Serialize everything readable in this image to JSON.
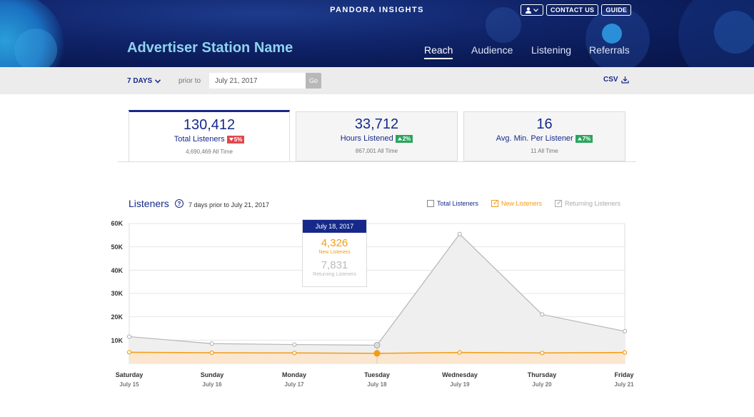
{
  "header": {
    "brand": "PANDORA INSIGHTS",
    "contact_label": "CONTACT US",
    "guide_label": "GUIDE",
    "station_name": "Advertiser Station Name",
    "nav": [
      "Reach",
      "Audience",
      "Listening",
      "Referrals"
    ],
    "active_nav": "Reach",
    "user_icon": "user-icon"
  },
  "filters": {
    "range_label": "7 DAYS",
    "prior_label": "prior to",
    "date_value": "July 21, 2017",
    "go_label": "Go",
    "csv_label": "CSV"
  },
  "stats": [
    {
      "value": "130,412",
      "label": "Total Listeners",
      "change": "5%",
      "direction": "down",
      "all_time": "4,690,469 All Time"
    },
    {
      "value": "33,712",
      "label": "Hours Listened",
      "change": "2%",
      "direction": "up",
      "all_time": "867,001 All Time"
    },
    {
      "value": "16",
      "label": "Avg. Min. Per Listener",
      "change": "7%",
      "direction": "up",
      "all_time": "11 All Time"
    }
  ],
  "chart": {
    "title": "Listeners",
    "subtitle": "7 days prior to July 21, 2017",
    "legend": [
      {
        "label": "Total Listeners",
        "checked": false,
        "color": "#16298a"
      },
      {
        "label": "New Listeners",
        "checked": true,
        "color": "#f39c12"
      },
      {
        "label": "Returning Listeners",
        "checked": true,
        "color": "#aaaaaa"
      }
    ],
    "tooltip": {
      "date": "July 18, 2017",
      "new_value": "4,326",
      "new_label": "New Listeners",
      "returning_value": "7,831",
      "returning_label": "Returning Listeners"
    },
    "days": [
      "Saturday",
      "Sunday",
      "Monday",
      "Tuesday",
      "Wednesday",
      "Thursday",
      "Friday"
    ],
    "dates": [
      "July 15",
      "July 16",
      "July 17",
      "July 18",
      "July 19",
      "July 20",
      "July 21"
    ],
    "y_ticks": [
      "60K",
      "50K",
      "40K",
      "30K",
      "20K",
      "10K"
    ]
  },
  "chart_data": {
    "type": "area",
    "title": "Listeners",
    "x": [
      "July 15",
      "July 16",
      "July 17",
      "July 18",
      "July 19",
      "July 20",
      "July 21"
    ],
    "ylim": [
      0,
      60000
    ],
    "grid": true,
    "legend_position": "top-right",
    "series": [
      {
        "name": "New Listeners",
        "color": "#f39c12",
        "values": [
          4800,
          4600,
          4500,
          4326,
          4700,
          4500,
          4700
        ]
      },
      {
        "name": "Returning Listeners",
        "color": "#bbbbbb",
        "values": [
          11500,
          8500,
          8100,
          7831,
          55500,
          21000,
          13800
        ]
      }
    ]
  }
}
